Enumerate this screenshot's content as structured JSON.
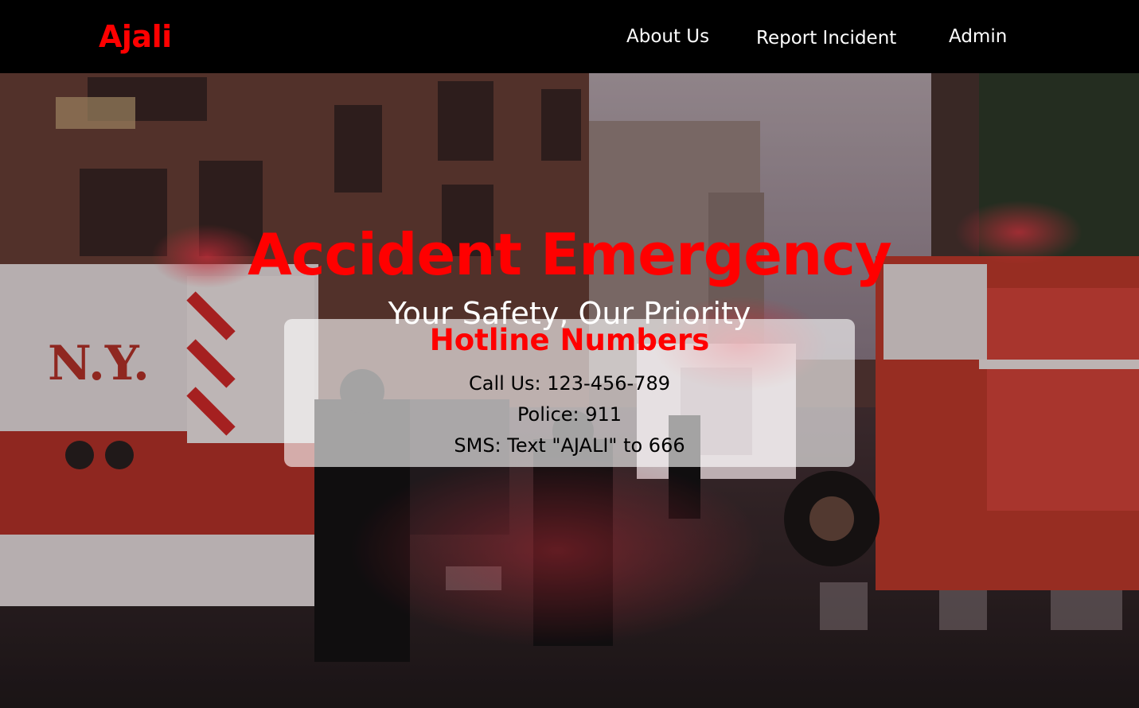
{
  "nav": {
    "brand": "Ajali",
    "links": [
      "About Us",
      "Report Incident",
      "Admin"
    ]
  },
  "hero": {
    "title": "Accident Emergency",
    "subtitle": "Your Safety, Our Priority",
    "background_icon": "street-emergency-photo"
  },
  "hotline": {
    "title": "Hotline Numbers",
    "lines": [
      "Call Us: 123-456-789",
      "Police: 911",
      "SMS: Text \"AJALI\" to 666"
    ]
  },
  "colors": {
    "accent": "#ff0000",
    "navbar": "#000000",
    "card": "#ffffffa0"
  }
}
